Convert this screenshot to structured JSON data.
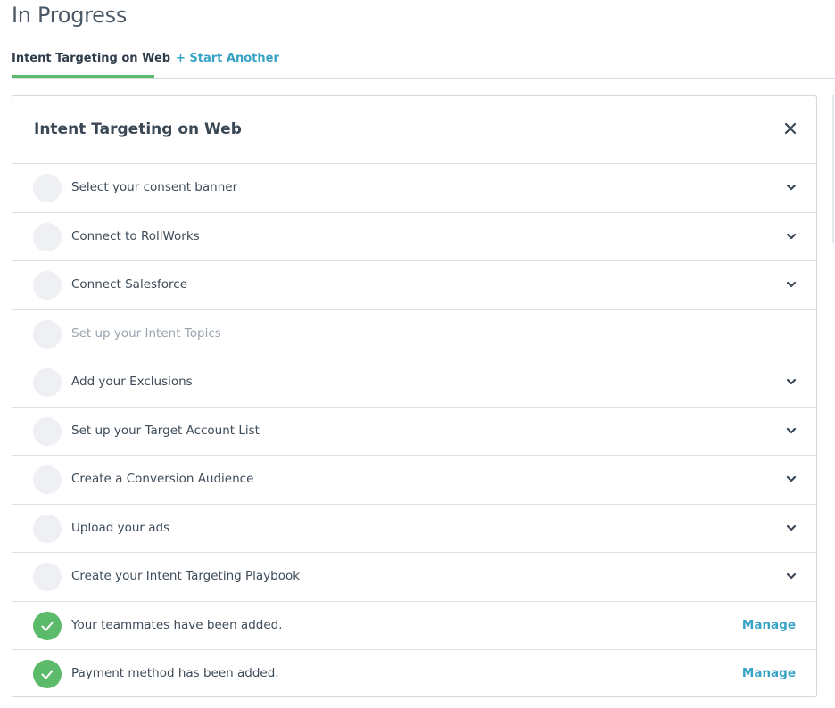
{
  "page": {
    "title": "In Progress"
  },
  "tabs": [
    {
      "label": "Intent Targeting on Web",
      "active": true
    },
    {
      "label": "+ Start Another",
      "active": false
    }
  ],
  "card": {
    "title": "Intent Targeting on Web",
    "close_icon": "close-icon",
    "steps": [
      {
        "label": "Select your consent banner",
        "status": "pending",
        "action": "chevron-down-icon"
      },
      {
        "label": "Connect to RollWorks",
        "status": "pending",
        "action": "chevron-down-icon"
      },
      {
        "label": "Connect Salesforce",
        "status": "pending",
        "action": "chevron-down-icon"
      },
      {
        "label": "Set up your Intent Topics",
        "status": "disabled",
        "action": ""
      },
      {
        "label": "Add your Exclusions",
        "status": "pending",
        "action": "chevron-down-icon"
      },
      {
        "label": "Set up your Target Account List",
        "status": "pending",
        "action": "chevron-down-icon"
      },
      {
        "label": "Create a Conversion Audience",
        "status": "pending",
        "action": "chevron-down-icon"
      },
      {
        "label": "Upload your ads",
        "status": "pending",
        "action": "chevron-down-icon"
      },
      {
        "label": "Create your Intent Targeting Playbook",
        "status": "pending",
        "action": "chevron-down-icon"
      },
      {
        "label": "Your teammates have been added.",
        "status": "done",
        "action": "Manage"
      },
      {
        "label": "Payment method has been added.",
        "status": "done",
        "action": "Manage"
      }
    ]
  },
  "colors": {
    "accent_green": "#5cba6b",
    "link_blue": "#36a3c6",
    "pending_circle": "#eef0f4"
  }
}
